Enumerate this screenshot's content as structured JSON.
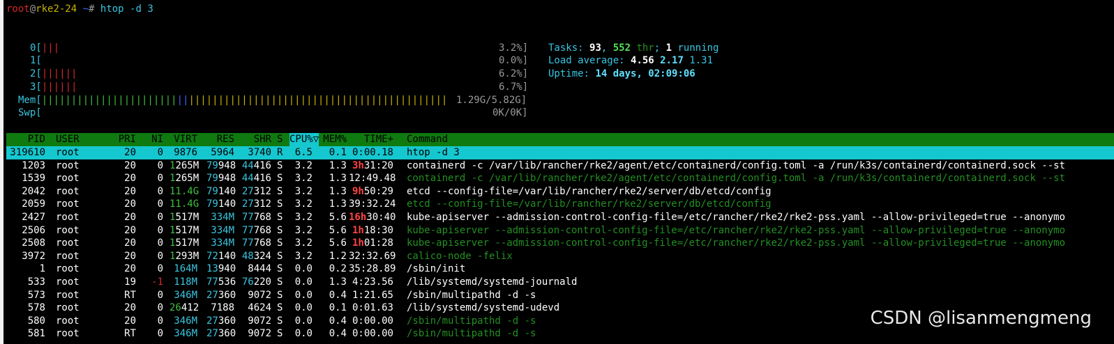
{
  "prompt": {
    "user": "root",
    "at": "@",
    "host": "rke2-24",
    "path": " ~",
    "hash": "#",
    "command": " htop -d 3"
  },
  "cpus": [
    {
      "label": "0[",
      "bars": "|||",
      "percent": "3.2%]"
    },
    {
      "label": "1[",
      "bars": "",
      "percent": "0.0%]"
    },
    {
      "label": "2[",
      "bars": "||||||",
      "percent": "6.2%]"
    },
    {
      "label": "3[",
      "bars": "||||||",
      "percent": "6.7%]"
    }
  ],
  "mem": {
    "label": "Mem[",
    "bars_green": "|||||||||||||||||||||||",
    "bars_blue": "||",
    "bars_yellow": "||||||||||||||||||||||||||||||||||||||||||||",
    "value": "1.29G/5.82G]"
  },
  "swp": {
    "label": "Swp[",
    "value": "0K/0K]"
  },
  "tasks": {
    "label": "Tasks: ",
    "count": "93",
    "sep": ", ",
    "thr": "552",
    "thr_label": " thr",
    "sep2": "; ",
    "running": "1",
    "running_label": " running"
  },
  "load": {
    "label": "Load average: ",
    "l1": "4.56",
    "l5": "2.17",
    "l15": "1.31"
  },
  "uptime": {
    "label": "Uptime: ",
    "value": "14 days, 02:09:06"
  },
  "table": {
    "headers": {
      "pid": "PID",
      "user": "USER",
      "pri": "PRI",
      "ni": "NI",
      "virt": "VIRT",
      "res": "RES",
      "shr": "SHR",
      "s": "S",
      "cpu": "CPU%▽",
      "mem": "MEM%",
      "time": "TIME+",
      "command": "Command"
    },
    "rows": [
      {
        "pid": "319610",
        "user": "root",
        "pri": "20",
        "ni": "0",
        "virt": "9876",
        "res": "5964",
        "shr": "3740",
        "s": "R",
        "cpu": "6.5",
        "mem": "0.1",
        "time": "0:00.18",
        "command": "htop -d 3"
      },
      {
        "pid": "1203",
        "user": "root",
        "pri": "20",
        "ni": "0",
        "virt": "1265M",
        "res": "79948",
        "shr": "44416",
        "s": "S",
        "cpu": "3.2",
        "mem": "1.3",
        "time": "3h31:20",
        "command": "containerd -c /var/lib/rancher/rke2/agent/etc/containerd/config.toml -a /run/k3s/containerd/containerd.sock --st"
      },
      {
        "pid": "1539",
        "user": "root",
        "pri": "20",
        "ni": "0",
        "virt": "1265M",
        "res": "79948",
        "shr": "44416",
        "s": "S",
        "cpu": "3.2",
        "mem": "1.3",
        "time": "12:49.48",
        "command": "containerd -c /var/lib/rancher/rke2/agent/etc/containerd/config.toml -a /run/k3s/containerd/containerd.sock --st"
      },
      {
        "pid": "2042",
        "user": "root",
        "pri": "20",
        "ni": "0",
        "virt": "11.4G",
        "res": "79140",
        "shr": "27312",
        "s": "S",
        "cpu": "3.2",
        "mem": "1.3",
        "time": "9h50:29",
        "command": "etcd --config-file=/var/lib/rancher/rke2/server/db/etcd/config"
      },
      {
        "pid": "2059",
        "user": "root",
        "pri": "20",
        "ni": "0",
        "virt": "11.4G",
        "res": "79140",
        "shr": "27312",
        "s": "S",
        "cpu": "3.2",
        "mem": "1.3",
        "time": "39:32.24",
        "command": "etcd --config-file=/var/lib/rancher/rke2/server/db/etcd/config"
      },
      {
        "pid": "2427",
        "user": "root",
        "pri": "20",
        "ni": "0",
        "virt": "1517M",
        "res": "334M",
        "shr": "77768",
        "s": "S",
        "cpu": "3.2",
        "mem": "5.6",
        "time": "16h30:40",
        "command": "kube-apiserver --admission-control-config-file=/etc/rancher/rke2/rke2-pss.yaml --allow-privileged=true --anonymo"
      },
      {
        "pid": "2506",
        "user": "root",
        "pri": "20",
        "ni": "0",
        "virt": "1517M",
        "res": "334M",
        "shr": "77768",
        "s": "S",
        "cpu": "3.2",
        "mem": "5.6",
        "time": "1h18:30",
        "command": "kube-apiserver --admission-control-config-file=/etc/rancher/rke2/rke2-pss.yaml --allow-privileged=true --anonymo"
      },
      {
        "pid": "2508",
        "user": "root",
        "pri": "20",
        "ni": "0",
        "virt": "1517M",
        "res": "334M",
        "shr": "77768",
        "s": "S",
        "cpu": "3.2",
        "mem": "5.6",
        "time": "1h01:28",
        "command": "kube-apiserver --admission-control-config-file=/etc/rancher/rke2/rke2-pss.yaml --allow-privileged=true --anonymo"
      },
      {
        "pid": "3972",
        "user": "root",
        "pri": "20",
        "ni": "0",
        "virt": "1293M",
        "res": "72140",
        "shr": "48324",
        "s": "S",
        "cpu": "3.2",
        "mem": "1.2",
        "time": "32:32.69",
        "command": "calico-node -felix"
      },
      {
        "pid": "1",
        "user": "root",
        "pri": "20",
        "ni": "0",
        "virt": "164M",
        "res": "13940",
        "shr": "8444",
        "s": "S",
        "cpu": "0.0",
        "mem": "0.2",
        "time": "35:28.89",
        "command": "/sbin/init"
      },
      {
        "pid": "533",
        "user": "root",
        "pri": "19",
        "ni": "-1",
        "virt": "118M",
        "res": "77536",
        "shr": "76220",
        "s": "S",
        "cpu": "0.0",
        "mem": "1.3",
        "time": "4:23.56",
        "command": "/lib/systemd/systemd-journald"
      },
      {
        "pid": "573",
        "user": "root",
        "pri": "RT",
        "ni": "0",
        "virt": "346M",
        "res": "27360",
        "shr": "9072",
        "s": "S",
        "cpu": "0.0",
        "mem": "0.4",
        "time": "1:21.65",
        "command": "/sbin/multipathd -d -s"
      },
      {
        "pid": "578",
        "user": "root",
        "pri": "20",
        "ni": "0",
        "virt": "26412",
        "res": "7188",
        "shr": "4624",
        "s": "S",
        "cpu": "0.0",
        "mem": "0.1",
        "time": "0:01.63",
        "command": "/lib/systemd/systemd-udevd"
      },
      {
        "pid": "580",
        "user": "root",
        "pri": "20",
        "ni": "0",
        "virt": "346M",
        "res": "27360",
        "shr": "9072",
        "s": "S",
        "cpu": "0.0",
        "mem": "0.4",
        "time": "0:00.00",
        "command": "/sbin/multipathd -d -s"
      },
      {
        "pid": "581",
        "user": "root",
        "pri": "RT",
        "ni": "0",
        "virt": "346M",
        "res": "27360",
        "shr": "9072",
        "s": "S",
        "cpu": "0.0",
        "mem": "0.4",
        "time": "0:00.00",
        "command": "/sbin/multipathd -d -s"
      }
    ]
  },
  "watermark": "CSDN @lisanmengmeng"
}
